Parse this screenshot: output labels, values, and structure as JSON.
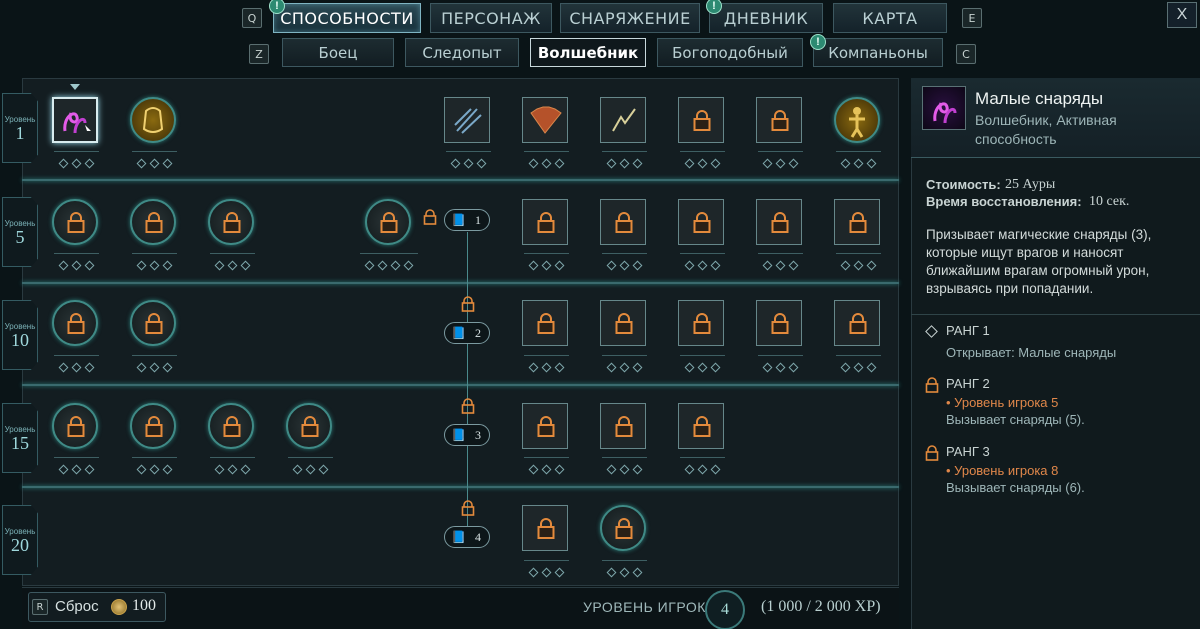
{
  "nav": {
    "key_left": "Q",
    "key_right": "E",
    "tabs": [
      {
        "label": "СПОСОБНОСТИ",
        "active": true,
        "notification": "!"
      },
      {
        "label": "ПЕРСОНАЖ",
        "active": false
      },
      {
        "label": "СНАРЯЖЕНИЕ",
        "active": false
      },
      {
        "label": "ДНЕВНИК",
        "active": false,
        "notification": "!"
      },
      {
        "label": "КАРТА",
        "active": false
      }
    ],
    "close_label": "X"
  },
  "subnav": {
    "key_left": "Z",
    "key_right": "C",
    "tabs": [
      {
        "label": "Боец",
        "active": false
      },
      {
        "label": "Следопыт",
        "active": false
      },
      {
        "label": "Волшебник",
        "active": true
      },
      {
        "label": "Богоподобный",
        "active": false
      },
      {
        "label": "Компаньоны",
        "active": false,
        "notification": "!"
      }
    ]
  },
  "tree": {
    "rows": [
      {
        "level_word": "Уровень",
        "level": "1"
      },
      {
        "level_word": "Уровень",
        "level": "5"
      },
      {
        "level_word": "Уровень",
        "level": "10"
      },
      {
        "level_word": "Уровень",
        "level": "15"
      },
      {
        "level_word": "Уровень",
        "level": "20"
      }
    ],
    "book_numbers": [
      "1",
      "2",
      "3",
      "4"
    ]
  },
  "bottom": {
    "reset_key": "R",
    "reset_label": "Сброс",
    "reset_cost": "100",
    "player_level_label": "УРОВЕНЬ ИГРОКА",
    "player_level": "4",
    "xp": "(1 000 / 2 000 XP)"
  },
  "detail": {
    "title": "Малые снаряды",
    "subtitle": "Волшебник, Активная способность",
    "cost_label": "Стоимость:",
    "cost_value": "25 Ауры",
    "cooldown_label": "Время восстановления:",
    "cooldown_value": "10 сек.",
    "description": "Призывает магические снаряды (3), которые ищут врагов и наносят ближайшим врагам огромный урон, взрываясь при попадании.",
    "ranks": [
      {
        "title": "РАНГ 1",
        "requirement": "",
        "effect": "Открывает: Малые снаряды",
        "locked": false
      },
      {
        "title": "РАНГ 2",
        "requirement": "• Уровень игрока 5",
        "effect": "Вызывает снаряды (5).",
        "locked": true
      },
      {
        "title": "РАНГ 3",
        "requirement": "• Уровень игрока 8",
        "effect": "Вызывает снаряды (6).",
        "locked": true
      }
    ]
  },
  "colors": {
    "accent_teal": "#3f8a86",
    "lock_orange": "#e38a3c",
    "requirement_orange": "#e0874a",
    "notification_green": "#2d8a72"
  }
}
